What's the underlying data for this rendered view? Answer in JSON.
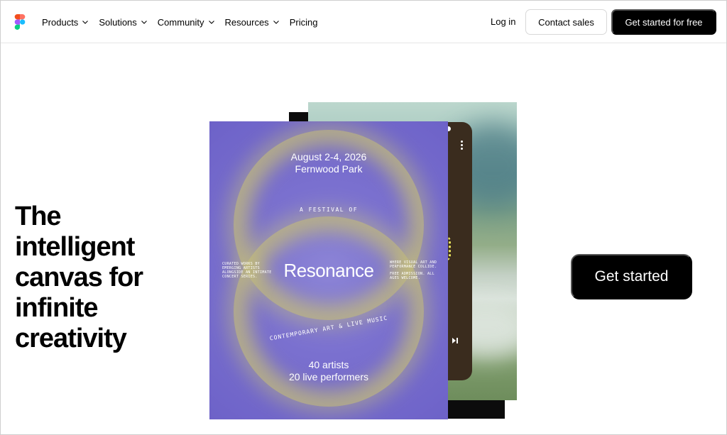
{
  "nav": {
    "logo": "figma-logo-icon",
    "items": [
      {
        "label": "Products",
        "has_dropdown": true
      },
      {
        "label": "Solutions",
        "has_dropdown": true
      },
      {
        "label": "Community",
        "has_dropdown": true
      },
      {
        "label": "Resources",
        "has_dropdown": true
      },
      {
        "label": "Pricing",
        "has_dropdown": false
      }
    ],
    "login": "Log in",
    "contact_sales": "Contact sales",
    "get_started_free": "Get started for free"
  },
  "hero": {
    "headline": "The intelligent canvas for infinite creativity",
    "cta": "Get started"
  },
  "poster": {
    "date": "August 2-4, 2026",
    "venue": "Fernwood Park",
    "festival_of": "A FESTIVAL OF",
    "title": "Resonance",
    "left_blurb": "CURATED WORKS BY EMERGING ARTISTS ALONGSIDE AN INTIMATE CONCERT SERIES.",
    "right_blurb": "WHERE VISUAL ART AND PERFORMANCE COLLIDE.",
    "right_blurb_2": "FREE ADMISSION. ALL AGES WELCOME.",
    "subtitle": "CONTEMPORARY ART & LIVE MUSIC",
    "artists": "40 artists",
    "performers": "20 live performers"
  },
  "colors": {
    "primary": "#000000",
    "poster_purple": "#7a70cf",
    "poster_ring": "#c4be78",
    "phone_bg": "#3a2c1e"
  }
}
